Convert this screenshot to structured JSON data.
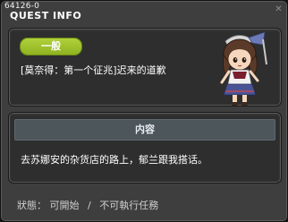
{
  "window": {
    "id_text": "64126-0",
    "title": "QUEST INFO"
  },
  "quest": {
    "badge": "一般",
    "name": "[莫奈得：第一个征兆]迟来的道歉",
    "npc_icon": "npc-girl-portrait-icon"
  },
  "content": {
    "header": "内容",
    "text": "去苏娜安的杂货店的路上，郁兰跟我搭话。"
  },
  "status": {
    "label": "狀態：",
    "value_1": "可開始",
    "separator": "/",
    "value_2": "不可執行任務"
  },
  "colors": {
    "window_bg": "#3e3e3e",
    "panel_bg": "#2e2e2e",
    "badge_green": "#9dc12c",
    "header_bg": "#4d565b"
  }
}
